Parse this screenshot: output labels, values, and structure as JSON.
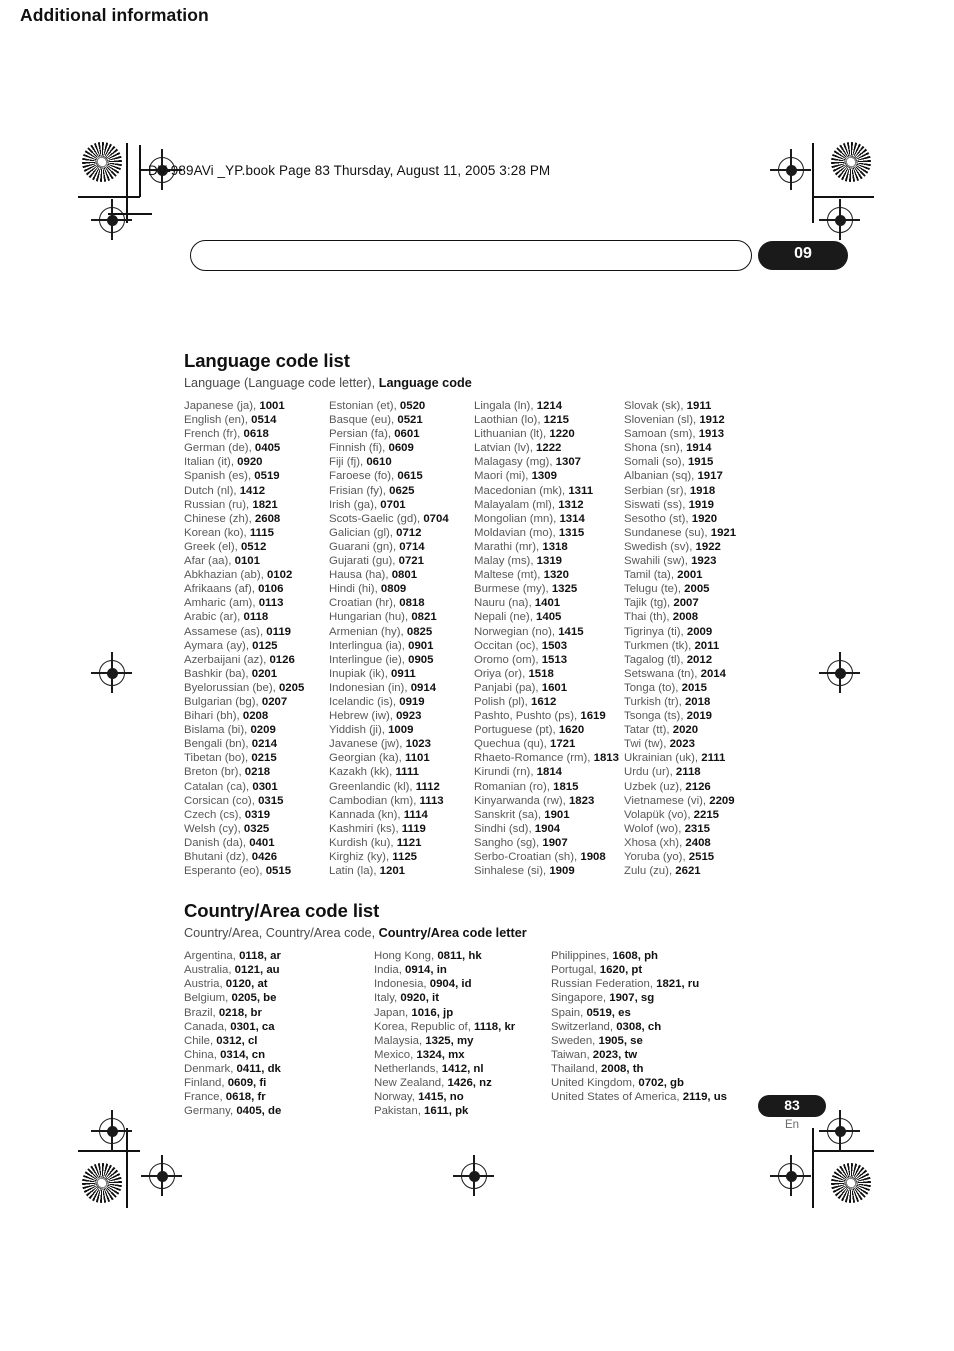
{
  "page": {
    "file_line": "DV-989AVi _YP.book  Page 83  Thursday, August 11, 2005  3:28 PM",
    "folio_number": "83",
    "folio_language": "En"
  },
  "banner": {
    "title": "Additional information",
    "chapter": "09"
  },
  "language_section": {
    "title": "Language code list",
    "subtitle_plain": "Language (Language code letter), ",
    "subtitle_bold": "Language code",
    "columns": [
      [
        {
          "name": "Japanese (ja), ",
          "code": "1001"
        },
        {
          "name": "English (en), ",
          "code": "0514"
        },
        {
          "name": "French (fr), ",
          "code": "0618"
        },
        {
          "name": "German (de), ",
          "code": "0405"
        },
        {
          "name": "Italian (it), ",
          "code": "0920"
        },
        {
          "name": "Spanish (es), ",
          "code": "0519"
        },
        {
          "name": "Dutch (nl), ",
          "code": "1412"
        },
        {
          "name": "Russian (ru), ",
          "code": "1821"
        },
        {
          "name": "Chinese (zh), ",
          "code": "2608"
        },
        {
          "name": "Korean (ko), ",
          "code": "1115"
        },
        {
          "name": "Greek (el), ",
          "code": "0512"
        },
        {
          "name": "Afar (aa), ",
          "code": "0101"
        },
        {
          "name": "Abkhazian (ab), ",
          "code": "0102"
        },
        {
          "name": "Afrikaans (af), ",
          "code": "0106"
        },
        {
          "name": "Amharic (am), ",
          "code": "0113"
        },
        {
          "name": "Arabic (ar), ",
          "code": "0118"
        },
        {
          "name": "Assamese (as), ",
          "code": "0119"
        },
        {
          "name": "Aymara (ay), ",
          "code": "0125"
        },
        {
          "name": "Azerbaijani (az), ",
          "code": "0126"
        },
        {
          "name": "Bashkir (ba), ",
          "code": "0201"
        },
        {
          "name": "Byelorussian (be), ",
          "code": "0205"
        },
        {
          "name": "Bulgarian (bg), ",
          "code": "0207"
        },
        {
          "name": "Bihari (bh), ",
          "code": "0208"
        },
        {
          "name": "Bislama (bi), ",
          "code": "0209"
        },
        {
          "name": "Bengali (bn), ",
          "code": "0214"
        },
        {
          "name": "Tibetan (bo), ",
          "code": "0215"
        },
        {
          "name": "Breton (br), ",
          "code": "0218"
        },
        {
          "name": "Catalan (ca), ",
          "code": "0301"
        },
        {
          "name": "Corsican (co), ",
          "code": "0315"
        },
        {
          "name": "Czech (cs), ",
          "code": "0319"
        },
        {
          "name": "Welsh (cy), ",
          "code": "0325"
        },
        {
          "name": "Danish (da), ",
          "code": "0401"
        },
        {
          "name": "Bhutani (dz), ",
          "code": "0426"
        },
        {
          "name": "Esperanto (eo), ",
          "code": "0515"
        }
      ],
      [
        {
          "name": "Estonian (et), ",
          "code": "0520"
        },
        {
          "name": "Basque (eu), ",
          "code": "0521"
        },
        {
          "name": "Persian (fa), ",
          "code": "0601"
        },
        {
          "name": "Finnish (fi), ",
          "code": "0609"
        },
        {
          "name": "Fiji (fj), ",
          "code": "0610"
        },
        {
          "name": "Faroese (fo), ",
          "code": "0615"
        },
        {
          "name": "Frisian (fy), ",
          "code": "0625"
        },
        {
          "name": "Irish (ga), ",
          "code": "0701"
        },
        {
          "name": "Scots-Gaelic (gd), ",
          "code": "0704"
        },
        {
          "name": "Galician (gl), ",
          "code": "0712"
        },
        {
          "name": "Guarani (gn), ",
          "code": "0714"
        },
        {
          "name": "Gujarati (gu), ",
          "code": "0721"
        },
        {
          "name": "Hausa (ha), ",
          "code": "0801"
        },
        {
          "name": "Hindi (hi), ",
          "code": "0809"
        },
        {
          "name": "Croatian (hr), ",
          "code": "0818"
        },
        {
          "name": "Hungarian (hu), ",
          "code": "0821"
        },
        {
          "name": "Armenian (hy), ",
          "code": "0825"
        },
        {
          "name": "Interlingua (ia), ",
          "code": "0901"
        },
        {
          "name": "Interlingue (ie), ",
          "code": "0905"
        },
        {
          "name": "Inupiak (ik), ",
          "code": "0911"
        },
        {
          "name": "Indonesian (in), ",
          "code": "0914"
        },
        {
          "name": "Icelandic (is), ",
          "code": "0919"
        },
        {
          "name": "Hebrew (iw), ",
          "code": "0923"
        },
        {
          "name": "Yiddish (ji), ",
          "code": "1009"
        },
        {
          "name": "Javanese (jw), ",
          "code": "1023"
        },
        {
          "name": "Georgian (ka), ",
          "code": "1101"
        },
        {
          "name": "Kazakh (kk), ",
          "code": "1111"
        },
        {
          "name": "Greenlandic  (kl), ",
          "code": "1112"
        },
        {
          "name": "Cambodian (km), ",
          "code": "1113"
        },
        {
          "name": "Kannada (kn), ",
          "code": "1114"
        },
        {
          "name": "Kashmiri (ks), ",
          "code": "1119"
        },
        {
          "name": "Kurdish (ku), ",
          "code": "1121"
        },
        {
          "name": "Kirghiz (ky), ",
          "code": "1125"
        },
        {
          "name": "Latin (la), ",
          "code": "1201"
        }
      ],
      [
        {
          "name": "Lingala (ln), ",
          "code": "1214"
        },
        {
          "name": "Laothian (lo), ",
          "code": "1215"
        },
        {
          "name": "Lithuanian (lt), ",
          "code": "1220"
        },
        {
          "name": "Latvian (lv), ",
          "code": "1222"
        },
        {
          "name": "Malagasy (mg), ",
          "code": "1307"
        },
        {
          "name": "Maori (mi), ",
          "code": "1309"
        },
        {
          "name": "Macedonian (mk), ",
          "code": "1311"
        },
        {
          "name": "Malayalam  (ml), ",
          "code": "1312"
        },
        {
          "name": "Mongolian (mn), ",
          "code": "1314"
        },
        {
          "name": "Moldavian (mo), ",
          "code": "1315"
        },
        {
          "name": "Marathi (mr), ",
          "code": "1318"
        },
        {
          "name": "Malay  (ms), ",
          "code": "1319"
        },
        {
          "name": "Maltese (mt), ",
          "code": "1320"
        },
        {
          "name": "Burmese (my), ",
          "code": "1325"
        },
        {
          "name": "Nauru (na), ",
          "code": "1401"
        },
        {
          "name": "Nepali (ne), ",
          "code": "1405"
        },
        {
          "name": "Norwegian (no), ",
          "code": "1415"
        },
        {
          "name": "Occitan (oc), ",
          "code": "1503"
        },
        {
          "name": "Oromo (om), ",
          "code": "1513"
        },
        {
          "name": "Oriya (or), ",
          "code": "1518"
        },
        {
          "name": "Panjabi (pa), ",
          "code": "1601"
        },
        {
          "name": "Polish (pl), ",
          "code": "1612"
        },
        {
          "name": "Pashto, Pushto (ps), ",
          "code": "1619"
        },
        {
          "name": "Portuguese (pt), ",
          "code": "1620"
        },
        {
          "name": "Quechua (qu), ",
          "code": "1721"
        },
        {
          "name": "Rhaeto-Romance (rm), ",
          "code": "1813"
        },
        {
          "name": "Kirundi (rn), ",
          "code": "1814"
        },
        {
          "name": "Romanian (ro), ",
          "code": "1815"
        },
        {
          "name": "Kinyarwanda (rw), ",
          "code": "1823"
        },
        {
          "name": "Sanskrit (sa), ",
          "code": "1901"
        },
        {
          "name": "Sindhi (sd), ",
          "code": "1904"
        },
        {
          "name": "Sangho (sg), ",
          "code": "1907"
        },
        {
          "name": "Serbo-Croatian (sh), ",
          "code": "1908"
        },
        {
          "name": "Sinhalese (si), ",
          "code": "1909"
        }
      ],
      [
        {
          "name": "Slovak (sk), ",
          "code": "1911"
        },
        {
          "name": "Slovenian (sl), ",
          "code": "1912"
        },
        {
          "name": "Samoan (sm), ",
          "code": "1913"
        },
        {
          "name": "Shona (sn), ",
          "code": "1914"
        },
        {
          "name": "Somali (so), ",
          "code": "1915"
        },
        {
          "name": "Albanian (sq), ",
          "code": "1917"
        },
        {
          "name": "Serbian (sr), ",
          "code": "1918"
        },
        {
          "name": "Siswati (ss), ",
          "code": "1919"
        },
        {
          "name": "Sesotho (st), ",
          "code": "1920"
        },
        {
          "name": "Sundanese (su), ",
          "code": "1921"
        },
        {
          "name": "Swedish (sv), ",
          "code": "1922"
        },
        {
          "name": "Swahili (sw), ",
          "code": "1923"
        },
        {
          "name": "Tamil (ta), ",
          "code": "2001"
        },
        {
          "name": "Telugu (te), ",
          "code": "2005"
        },
        {
          "name": "Tajik (tg), ",
          "code": "2007"
        },
        {
          "name": "Thai (th), ",
          "code": "2008"
        },
        {
          "name": "Tigrinya (ti), ",
          "code": "2009"
        },
        {
          "name": "Turkmen (tk), ",
          "code": "2011"
        },
        {
          "name": "Tagalog (tl), ",
          "code": "2012"
        },
        {
          "name": "Setswana (tn), ",
          "code": "2014"
        },
        {
          "name": "Tonga (to), ",
          "code": "2015"
        },
        {
          "name": "Turkish (tr), ",
          "code": "2018"
        },
        {
          "name": "Tsonga (ts), ",
          "code": "2019"
        },
        {
          "name": "Tatar (tt), ",
          "code": "2020"
        },
        {
          "name": "Twi (tw), ",
          "code": "2023"
        },
        {
          "name": "Ukrainian (uk), ",
          "code": "2111"
        },
        {
          "name": "Urdu (ur), ",
          "code": "2118"
        },
        {
          "name": "Uzbek (uz), ",
          "code": "2126"
        },
        {
          "name": "Vietnamese (vi), ",
          "code": "2209"
        },
        {
          "name": "Volapük (vo), ",
          "code": "2215"
        },
        {
          "name": "Wolof (wo), ",
          "code": "2315"
        },
        {
          "name": "Xhosa (xh), ",
          "code": "2408"
        },
        {
          "name": "Yoruba (yo), ",
          "code": "2515"
        },
        {
          "name": "Zulu (zu), ",
          "code": "2621"
        }
      ]
    ]
  },
  "country_section": {
    "title": "Country/Area code list",
    "subtitle_plain": "Country/Area, Country/Area code, ",
    "subtitle_bold": "Country/Area code letter",
    "columns": [
      [
        {
          "name": "Argentina, ",
          "code": "0118, ar"
        },
        {
          "name": "Australia, ",
          "code": "0121, au"
        },
        {
          "name": "Austria, ",
          "code": "0120, at"
        },
        {
          "name": "Belgium, ",
          "code": "0205, be"
        },
        {
          "name": "Brazil, ",
          "code": "0218, br"
        },
        {
          "name": "Canada, ",
          "code": "0301, ca"
        },
        {
          "name": "Chile, ",
          "code": "0312, cl"
        },
        {
          "name": "China, ",
          "code": "0314, cn"
        },
        {
          "name": "Denmark, ",
          "code": "0411, dk"
        },
        {
          "name": "Finland, ",
          "code": "0609, fi"
        },
        {
          "name": "France, ",
          "code": "0618, fr"
        },
        {
          "name": "Germany, ",
          "code": "0405, de"
        }
      ],
      [
        {
          "name": "Hong Kong, ",
          "code": "0811, hk"
        },
        {
          "name": "India, ",
          "code": "0914, in"
        },
        {
          "name": "Indonesia, ",
          "code": "0904, id"
        },
        {
          "name": "Italy, ",
          "code": "0920, it"
        },
        {
          "name": "Japan, ",
          "code": "1016, jp"
        },
        {
          "name": "Korea, Republic of, ",
          "code": "1118, kr"
        },
        {
          "name": "Malaysia, ",
          "code": "1325, my"
        },
        {
          "name": "Mexico, ",
          "code": "1324, mx"
        },
        {
          "name": "Netherlands, ",
          "code": "1412, nl"
        },
        {
          "name": "New Zealand, ",
          "code": "1426, nz"
        },
        {
          "name": "Norway, ",
          "code": "1415, no"
        },
        {
          "name": "Pakistan, ",
          "code": "1611, pk"
        }
      ],
      [
        {
          "name": "Philippines, ",
          "code": "1608, ph"
        },
        {
          "name": "Portugal, ",
          "code": "1620, pt"
        },
        {
          "name": "Russian Federation, ",
          "code": "1821, ru"
        },
        {
          "name": "Singapore, ",
          "code": "1907, sg"
        },
        {
          "name": "Spain, ",
          "code": "0519, es"
        },
        {
          "name": "Switzerland, ",
          "code": "0308, ch"
        },
        {
          "name": "Sweden, ",
          "code": "1905, se"
        },
        {
          "name": "Taiwan, ",
          "code": "2023, tw"
        },
        {
          "name": "Thailand, ",
          "code": "2008, th"
        },
        {
          "name": "United Kingdom, ",
          "code": "0702, gb"
        },
        {
          "name": "United States of America, ",
          "code": "2119, us"
        }
      ]
    ]
  }
}
